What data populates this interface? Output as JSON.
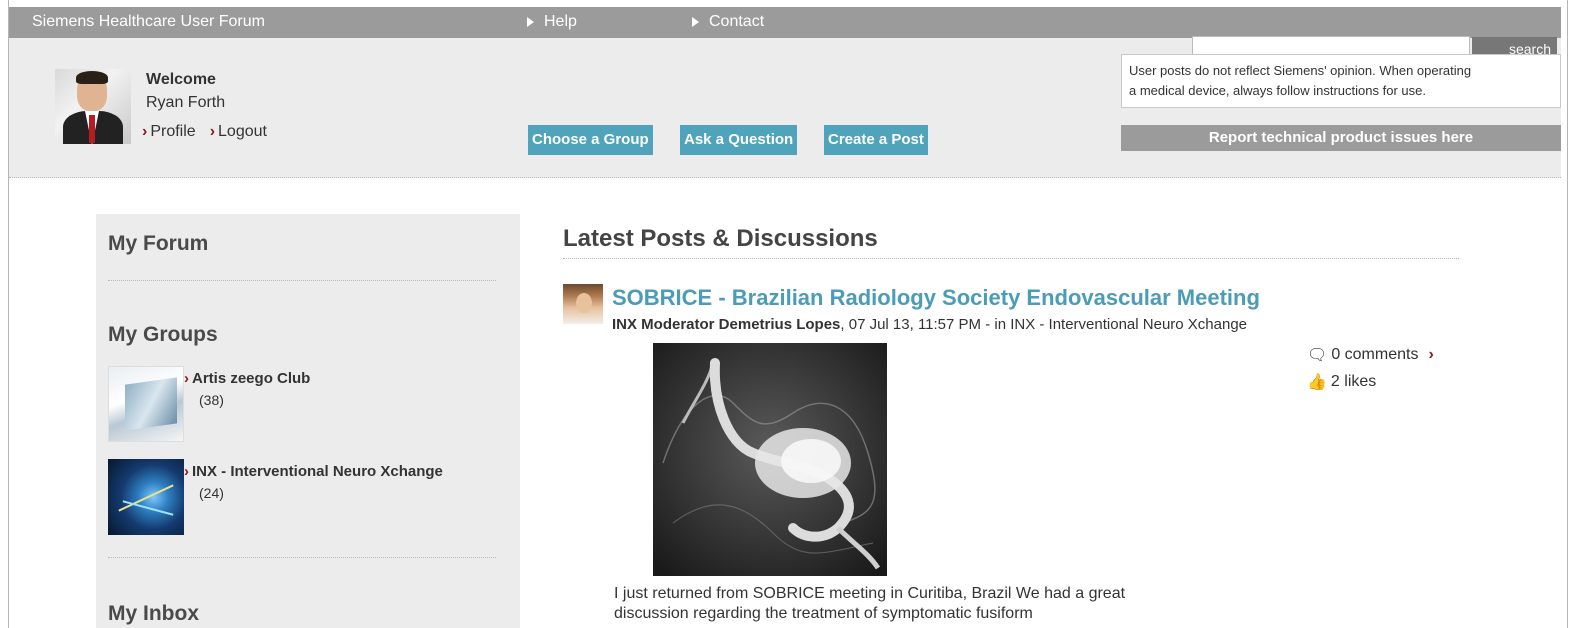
{
  "topbar": {
    "site_title": "Siemens Healthcare User Forum",
    "help": "Help",
    "contact": "Contact"
  },
  "header": {
    "welcome": "Welcome",
    "user_name": "Ryan Forth",
    "profile": "Profile",
    "logout": "Logout",
    "buttons": {
      "choose_group": "Choose a Group",
      "ask_question": "Ask a Question",
      "create_post": "Create a Post"
    },
    "search": {
      "value": "",
      "button": "search"
    },
    "disclaimer_line1": "User posts do not reflect Siemens' opinion. When operating",
    "disclaimer_line2": "a medical device, always follow instructions for use.",
    "report": "Report technical product issues here"
  },
  "sidebar": {
    "my_forum": "My Forum",
    "my_groups": "My Groups",
    "groups": [
      {
        "name": "Artis zeego Club",
        "count": "(38)"
      },
      {
        "name": "INX - Interventional Neuro Xchange",
        "count": "(24)"
      }
    ],
    "my_inbox": "My Inbox"
  },
  "main": {
    "heading": "Latest Posts & Discussions",
    "post": {
      "title": "SOBRICE - Brazilian Radiology Society Endovascular Meeting",
      "author": "INX Moderator Demetrius Lopes",
      "meta_rest": ", 07 Jul 13, 11:57 PM - in INX - Interventional Neuro Xchange",
      "comments": "0 comments",
      "likes": "2 likes",
      "body_line1": "I just returned from SOBRICE meeting in Curitiba, Brazil We had a great",
      "body_line2": "discussion regarding the treatment of symptomatic fusiform"
    }
  },
  "colors": {
    "accent_blue": "#4fa3bb",
    "bar_gray": "#9b9b9b",
    "chevron_red": "#8b1a1a"
  }
}
